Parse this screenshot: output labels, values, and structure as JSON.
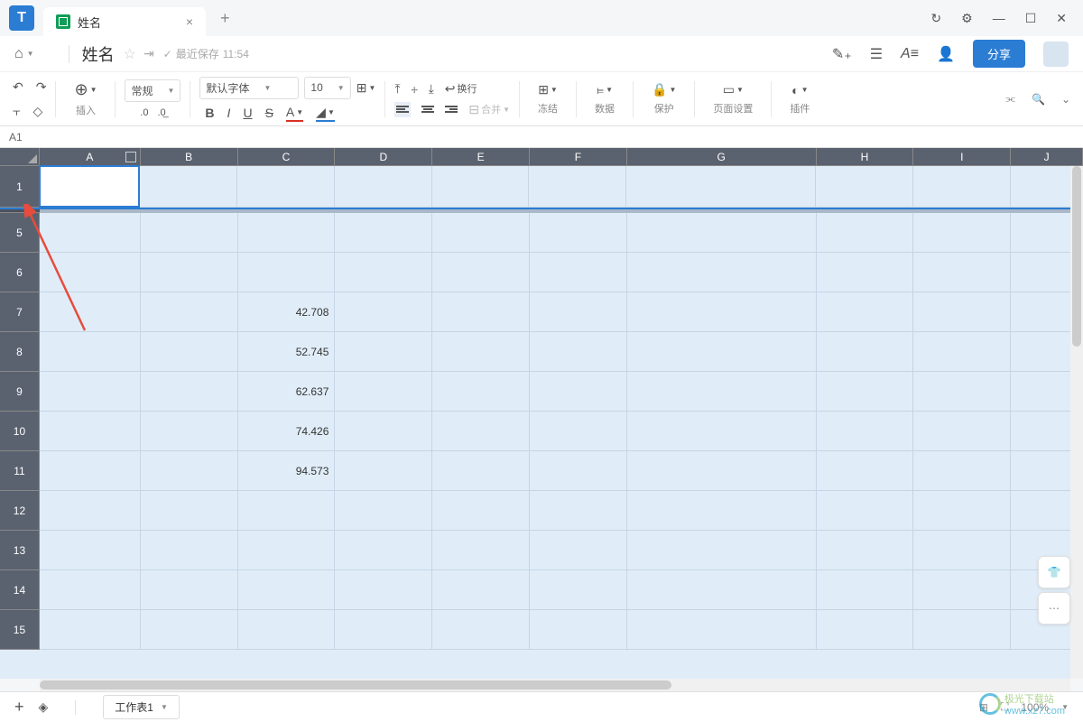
{
  "titlebar": {
    "tab_title": "姓名",
    "close": "×",
    "newtab": "+"
  },
  "window": {
    "sync": "↻",
    "settings": "⚙",
    "min": "—",
    "max": "☐",
    "close": "✕"
  },
  "docbar": {
    "title": "姓名",
    "saved_prefix": "最近保存",
    "saved_time": "11:54",
    "share": "分享"
  },
  "toolbar": {
    "insert": "插入",
    "format_number": "常规",
    "decimal": ".0",
    "decimal2": ".0",
    "font": "默认字体",
    "fontsize": "10",
    "bold": "B",
    "italic": "I",
    "underline": "U",
    "strike": "S",
    "fontcolor": "A",
    "bgcolor": "◢",
    "wrap": "换行",
    "merge": "合并",
    "freeze": "冻结",
    "data": "数据",
    "protect": "保护",
    "page": "页面设置",
    "plugin": "插件"
  },
  "cellref": "A1",
  "columns": [
    "A",
    "B",
    "C",
    "D",
    "E",
    "F",
    "G",
    "H",
    "I",
    "J"
  ],
  "rows": [
    "1",
    "5",
    "6",
    "7",
    "8",
    "9",
    "10",
    "11",
    "12",
    "13",
    "14",
    "15"
  ],
  "cells": {
    "7": {
      "C": "42.708"
    },
    "8": {
      "C": "52.745"
    },
    "9": {
      "C": "62.637"
    },
    "10": {
      "C": "74.426"
    },
    "11": {
      "C": "94.573"
    }
  },
  "statusbar": {
    "sheet": "工作表1",
    "zoom": "100%"
  },
  "watermark": {
    "text": "极光下载站",
    "url": "www.xz7.com"
  }
}
